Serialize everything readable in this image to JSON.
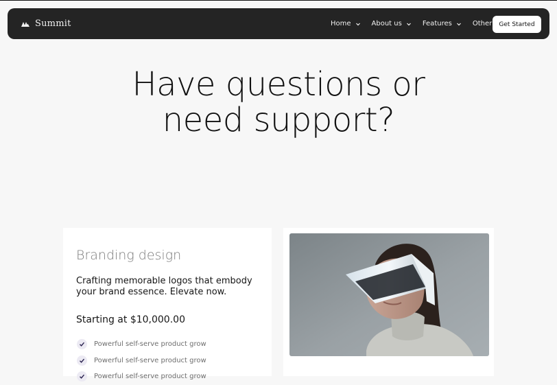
{
  "nav": {
    "brand": "Summit",
    "links": [
      {
        "label": "Home"
      },
      {
        "label": "About us"
      },
      {
        "label": "Features"
      },
      {
        "label": "Other"
      }
    ],
    "cta": "Get Started"
  },
  "hero": {
    "line1": "Have questions or",
    "line2": "need support?"
  },
  "card": {
    "title": "Branding design",
    "description": "Crafting memorable logos that embody your brand essence. Elevate now.",
    "price": "Starting at $10,000.00",
    "features": [
      "Powerful self-serve product grow",
      "Powerful self-serve product grow",
      "Powerful self-serve product grow"
    ]
  },
  "colors": {
    "nav_bg": "#242424",
    "page_bg": "#f7f7f7",
    "card_bg": "#ffffff",
    "check_bg": "#eceaf3"
  }
}
